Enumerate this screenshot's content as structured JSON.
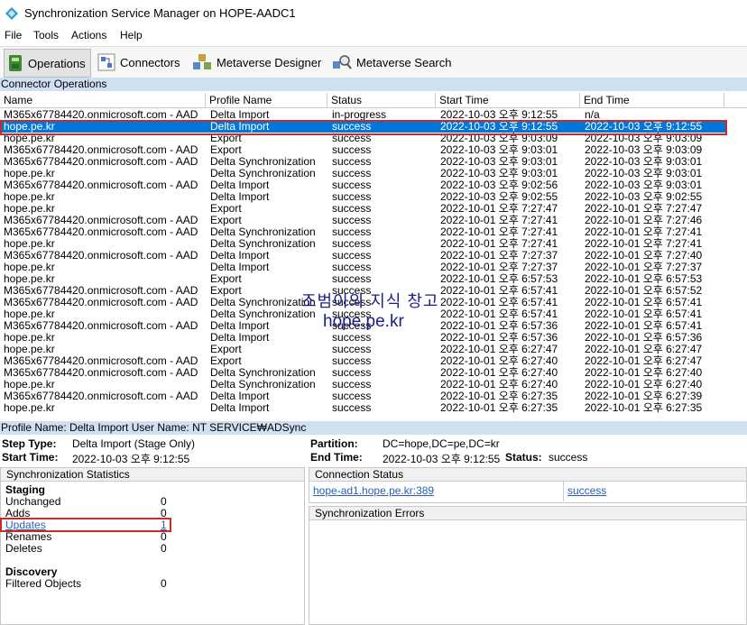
{
  "window": {
    "title": "Synchronization Service Manager on HOPE-AADC1"
  },
  "menu": [
    "File",
    "Tools",
    "Actions",
    "Help"
  ],
  "toolbar": {
    "operations": "Operations",
    "connectors": "Connectors",
    "metaverse_designer": "Metaverse Designer",
    "metaverse_search": "Metaverse Search"
  },
  "connector_operations": {
    "header": "Connector Operations",
    "columns": [
      "Name",
      "Profile Name",
      "Status",
      "Start Time",
      "End Time"
    ],
    "rows": [
      [
        "M365x67784420.onmicrosoft.com - AAD",
        "Delta Import",
        "in-progress",
        "2022-10-03 오후 9:12:55",
        "n/a"
      ],
      [
        "hope.pe.kr",
        "Delta Import",
        "success",
        "2022-10-03 오후 9:12:55",
        "2022-10-03 오후 9:12:55"
      ],
      [
        "hope.pe.kr",
        "Export",
        "success",
        "2022-10-03 오후 9:03:09",
        "2022-10-03 오후 9:03:09"
      ],
      [
        "M365x67784420.onmicrosoft.com - AAD",
        "Export",
        "success",
        "2022-10-03 오후 9:03:01",
        "2022-10-03 오후 9:03:09"
      ],
      [
        "M365x67784420.onmicrosoft.com - AAD",
        "Delta Synchronization",
        "success",
        "2022-10-03 오후 9:03:01",
        "2022-10-03 오후 9:03:01"
      ],
      [
        "hope.pe.kr",
        "Delta Synchronization",
        "success",
        "2022-10-03 오후 9:03:01",
        "2022-10-03 오후 9:03:01"
      ],
      [
        "M365x67784420.onmicrosoft.com - AAD",
        "Delta Import",
        "success",
        "2022-10-03 오후 9:02:56",
        "2022-10-03 오후 9:03:01"
      ],
      [
        "hope.pe.kr",
        "Delta Import",
        "success",
        "2022-10-03 오후 9:02:55",
        "2022-10-03 오후 9:02:55"
      ],
      [
        "hope.pe.kr",
        "Export",
        "success",
        "2022-10-01 오후 7:27:47",
        "2022-10-01 오후 7:27:47"
      ],
      [
        "M365x67784420.onmicrosoft.com - AAD",
        "Export",
        "success",
        "2022-10-01 오후 7:27:41",
        "2022-10-01 오후 7:27:46"
      ],
      [
        "M365x67784420.onmicrosoft.com - AAD",
        "Delta Synchronization",
        "success",
        "2022-10-01 오후 7:27:41",
        "2022-10-01 오후 7:27:41"
      ],
      [
        "hope.pe.kr",
        "Delta Synchronization",
        "success",
        "2022-10-01 오후 7:27:41",
        "2022-10-01 오후 7:27:41"
      ],
      [
        "M365x67784420.onmicrosoft.com - AAD",
        "Delta Import",
        "success",
        "2022-10-01 오후 7:27:37",
        "2022-10-01 오후 7:27:40"
      ],
      [
        "hope.pe.kr",
        "Delta Import",
        "success",
        "2022-10-01 오후 7:27:37",
        "2022-10-01 오후 7:27:37"
      ],
      [
        "hope.pe.kr",
        "Export",
        "success",
        "2022-10-01 오후 6:57:53",
        "2022-10-01 오후 6:57:53"
      ],
      [
        "M365x67784420.onmicrosoft.com - AAD",
        "Export",
        "success",
        "2022-10-01 오후 6:57:41",
        "2022-10-01 오후 6:57:52"
      ],
      [
        "M365x67784420.onmicrosoft.com - AAD",
        "Delta Synchronization",
        "success",
        "2022-10-01 오후 6:57:41",
        "2022-10-01 오후 6:57:41"
      ],
      [
        "hope.pe.kr",
        "Delta Synchronization",
        "success",
        "2022-10-01 오후 6:57:41",
        "2022-10-01 오후 6:57:41"
      ],
      [
        "M365x67784420.onmicrosoft.com - AAD",
        "Delta Import",
        "success",
        "2022-10-01 오후 6:57:36",
        "2022-10-01 오후 6:57:41"
      ],
      [
        "hope.pe.kr",
        "Delta Import",
        "success",
        "2022-10-01 오후 6:57:36",
        "2022-10-01 오후 6:57:36"
      ],
      [
        "hope.pe.kr",
        "Export",
        "success",
        "2022-10-01 오후 6:27:47",
        "2022-10-01 오후 6:27:47"
      ],
      [
        "M365x67784420.onmicrosoft.com - AAD",
        "Export",
        "success",
        "2022-10-01 오후 6:27:40",
        "2022-10-01 오후 6:27:47"
      ],
      [
        "M365x67784420.onmicrosoft.com - AAD",
        "Delta Synchronization",
        "success",
        "2022-10-01 오후 6:27:40",
        "2022-10-01 오후 6:27:40"
      ],
      [
        "hope.pe.kr",
        "Delta Synchronization",
        "success",
        "2022-10-01 오후 6:27:40",
        "2022-10-01 오후 6:27:40"
      ],
      [
        "M365x67784420.onmicrosoft.com - AAD",
        "Delta Import",
        "success",
        "2022-10-01 오후 6:27:35",
        "2022-10-01 오후 6:27:39"
      ],
      [
        "hope.pe.kr",
        "Delta Import",
        "success",
        "2022-10-01 오후 6:27:35",
        "2022-10-01 오후 6:27:35"
      ]
    ]
  },
  "watermark": {
    "line1": "조범이의 지식 창고",
    "line2": "hope.pe.kr"
  },
  "details": {
    "header": "Profile Name: Delta Import  User Name: NT SERVICE₩ADSync",
    "step_type_label": "Step Type:",
    "step_type": "Delta Import (Stage Only)",
    "start_time_label": "Start Time:",
    "start_time": "2022-10-03 오후 9:12:55",
    "partition_label": "Partition:",
    "partition": "DC=hope,DC=pe,DC=kr",
    "end_time_label": "End Time:",
    "end_time": "2022-10-03 오후 9:12:55",
    "status_label": "Status:",
    "status": "success"
  },
  "sync_stats": {
    "header": "Synchronization Statistics",
    "staging_label": "Staging",
    "unchanged_label": "Unchanged",
    "unchanged": "0",
    "adds_label": "Adds",
    "adds": "0",
    "updates_label": "Updates",
    "updates": "1",
    "renames_label": "Renames",
    "renames": "0",
    "deletes_label": "Deletes",
    "deletes": "0",
    "discovery_label": "Discovery",
    "filtered_label": "Filtered Objects",
    "filtered": "0"
  },
  "connection_status": {
    "header": "Connection Status",
    "server": "hope-ad1.hope.pe.kr:389",
    "result": "success"
  },
  "sync_errors": {
    "header": "Synchronization Errors"
  },
  "colors": {
    "selection": "#0078d7",
    "section_bar": "#cfe0f1",
    "highlight_box": "#c72c2c",
    "link": "#2b5fb3"
  }
}
